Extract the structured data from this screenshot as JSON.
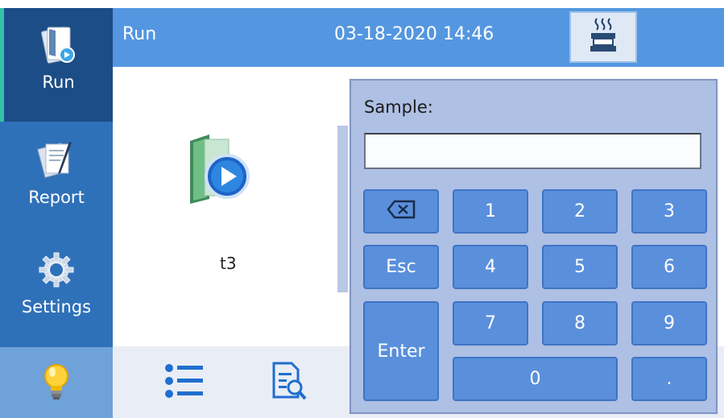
{
  "sidebar": {
    "items": [
      {
        "label": "Run",
        "icon": "run-book-icon",
        "active": true
      },
      {
        "label": "Report",
        "icon": "report-icon"
      },
      {
        "label": "Settings",
        "icon": "gear-icon"
      },
      {
        "label": "",
        "icon": "lightbulb-icon"
      }
    ]
  },
  "header": {
    "title": "Run",
    "datetime": "03-18-2020 14:46",
    "heater_icon": "heater-icon"
  },
  "content": {
    "files": [
      {
        "name": "t3",
        "icon": "play-folder-icon"
      }
    ]
  },
  "bottombar": {
    "icons": [
      "list-icon",
      "search-document-icon"
    ]
  },
  "keypad": {
    "label": "Sample:",
    "input_value": "",
    "keys": {
      "backspace": "backspace-icon",
      "esc": "Esc",
      "enter": "Enter",
      "k1": "1",
      "k2": "2",
      "k3": "3",
      "k4": "4",
      "k5": "5",
      "k6": "6",
      "k7": "7",
      "k8": "8",
      "k9": "9",
      "k0": "0",
      "dot": "."
    }
  },
  "colors": {
    "sidebar": "#2f71b9",
    "sidebar_active": "#1c4d86",
    "header": "#5497e0",
    "key": "#5a8fdc",
    "keypad_bg": "#aec0e4"
  }
}
